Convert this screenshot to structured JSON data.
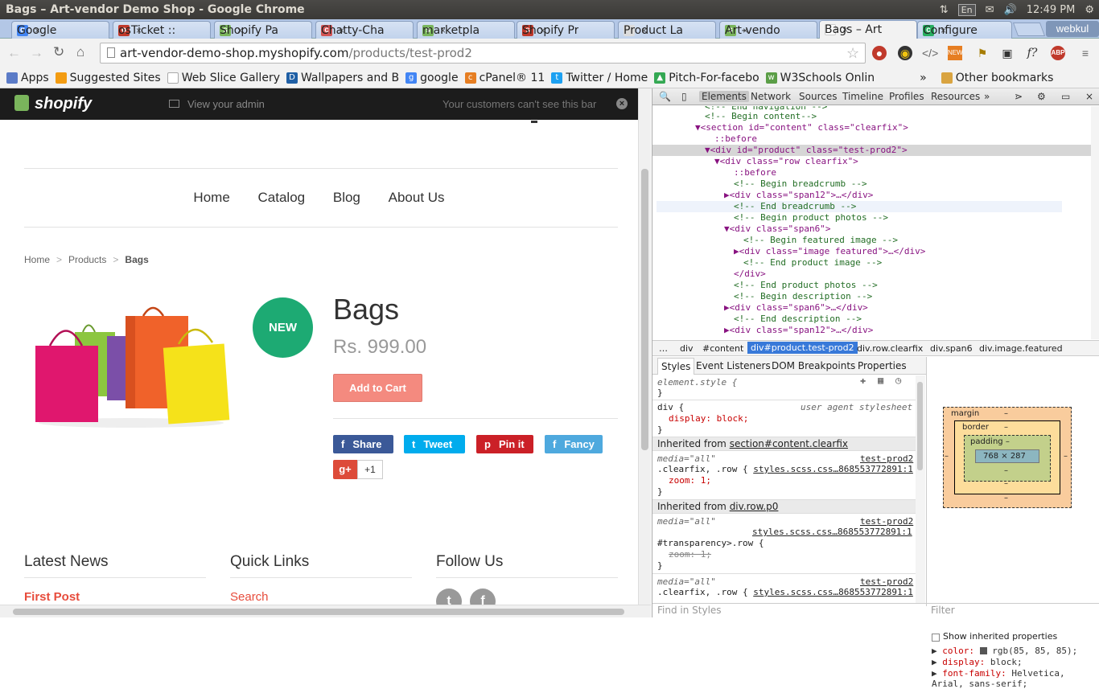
{
  "window": {
    "title": "Bags – Art-vendor Demo Shop - Google Chrome"
  },
  "indicators": {
    "lang": "En",
    "time": "12:49 PM"
  },
  "tabs": [
    {
      "label": "Google",
      "color": "#4285f4",
      "glyph": "g"
    },
    {
      "label": "osTicket ::",
      "color": "#c0392b",
      "glyph": "o"
    },
    {
      "label": "Shopify Pa",
      "color": "#7ab55c",
      "glyph": "s"
    },
    {
      "label": "Chatty-Cha",
      "color": "#d35454",
      "glyph": "c"
    },
    {
      "label": "marketpla",
      "color": "#7ab55c",
      "glyph": "s"
    },
    {
      "label": "Shopify Pr",
      "color": "#c0392b",
      "glyph": "s"
    },
    {
      "label": "Product La",
      "color": "#dcdcdc",
      "glyph": ""
    },
    {
      "label": "Art-vendo",
      "color": "#7ab55c",
      "glyph": "s"
    },
    {
      "label": "Bags – Art",
      "color": "#ffffff",
      "glyph": ""
    },
    {
      "label": "Configure",
      "color": "#27ae60",
      "glyph": "c"
    }
  ],
  "profile": {
    "label": "webkul"
  },
  "address": {
    "host": "art-vendor-demo-shop.myshopify.com",
    "path": "/products/test-prod2"
  },
  "bookmarks": [
    {
      "label": "Apps",
      "color": "#5b7bc7"
    },
    {
      "label": "Suggested Sites",
      "color": "#f39c12"
    },
    {
      "label": "Web Slice Gallery",
      "color": "#ffffff"
    },
    {
      "label": "Wallpapers and B",
      "color": "#1f5fa5"
    },
    {
      "label": "google",
      "color": "#4285f4"
    },
    {
      "label": "cPanel® 11",
      "color": "#e67e22"
    },
    {
      "label": "Twitter / Home",
      "color": "#1da1f2"
    },
    {
      "label": "Pitch-For-facebo",
      "color": "#34a853"
    },
    {
      "label": "W3Schools Onlin",
      "color": "#5b9e47"
    }
  ],
  "bookmarks_overflow": "»",
  "other_bookmarks": "Other bookmarks",
  "adminbar": {
    "logo": "shopify",
    "view_admin": "View your admin",
    "notice": "Your customers can't see this bar",
    "close": "×"
  },
  "nav": {
    "items": [
      "Home",
      "Catalog",
      "Blog",
      "About Us"
    ]
  },
  "breadcrumb": {
    "items": [
      "Home",
      "Products"
    ],
    "current": "Bags",
    "sep": ">"
  },
  "product": {
    "badge": "NEW",
    "title": "Bags",
    "price": "Rs. 999.00",
    "add_to_cart": "Add to Cart",
    "share": [
      {
        "label": "Share",
        "glyph": "f",
        "color": "#3b5998"
      },
      {
        "label": "Tweet",
        "glyph": "t",
        "color": "#00aced"
      },
      {
        "label": "Pin it",
        "glyph": "p",
        "color": "#cb2027"
      },
      {
        "label": "Fancy",
        "glyph": "f",
        "color": "#4ea9de"
      }
    ],
    "gplus": {
      "label": "g+",
      "count": "+1"
    }
  },
  "footer": {
    "latest_news": "Latest News",
    "latest_news_first": "First Post",
    "quick_links": "Quick Links",
    "quick_links_first": "Search",
    "follow_us": "Follow Us"
  },
  "colors": {
    "accent": "#e74c3c",
    "new_badge": "#1daa73",
    "add_cart": "#f48a7f"
  },
  "devtools": {
    "tabs": [
      "Elements",
      "Network",
      "Sources",
      "Timeline",
      "Profiles",
      "Resources",
      "»"
    ],
    "tree": [
      "<!-- End navigation -->",
      "<!-- Begin content-->",
      "▼<section id=\"content\" class=\"clearfix\">",
      "::before",
      "▼<div id=\"product\" class=\"test-prod2\">",
      "▼<div class=\"row clearfix\">",
      "::before",
      "<!-- Begin breadcrumb -->",
      "▶<div class=\"span12\">…</div>",
      "<!-- End breadcrumb -->",
      "<!-- Begin product photos -->",
      "▼<div class=\"span6\">",
      "<!-- Begin featured image -->",
      "▶<div class=\"image featured\">…</div>",
      "<!-- End product image -->",
      "</div>",
      "<!-- End product photos -->",
      "<!-- Begin description -->",
      "▶<div class=\"span6\">…</div>",
      "<!-- End description -->",
      "▶<div class=\"span12\">…</div>"
    ],
    "crumbs": {
      "more": "…",
      "items": [
        "div",
        "#content",
        "div#product.test-prod2",
        "div.row.clearfix",
        "div.span6",
        "div.image.featured"
      ]
    },
    "style_tabs": [
      "Styles",
      "Event Listeners",
      "DOM Breakpoints",
      "Properties"
    ],
    "styles": {
      "element_style": "element.style {",
      "close": "}",
      "div_rule": "div {",
      "ua": "user agent stylesheet",
      "display": "display: block;",
      "inh1": "Inherited from",
      "inh1_link": "section#content.clearfix",
      "media": "media=\"all\"",
      "src": "test-prod2",
      "src_file": "styles.scss.css…8685537728​91:1",
      "rule1": ".clearfix, .row {",
      "zoom": "zoom: 1;",
      "inh2_link": "div.row.p0",
      "rule2": "#transparency>.row {",
      "zoom_struck": "zoom: 1;",
      "rule3": ".clearfix, .row {"
    },
    "metrics": {
      "margin": "margin",
      "border": "border",
      "padding": "padding –",
      "content": "768 × 287",
      "dash": "–"
    },
    "computed": {
      "show_inherited": "Show inherited properties",
      "color_prop": "color:",
      "color_val": "rgb(85, 85, 85);",
      "display_prop": "display:",
      "display_val": "block;",
      "font_prop": "font-family:",
      "font_val": "Helvetica,",
      "font_val2": "Arial, sans-serif;"
    },
    "find_placeholder": "Find in Styles",
    "filter_placeholder": "Filter"
  }
}
